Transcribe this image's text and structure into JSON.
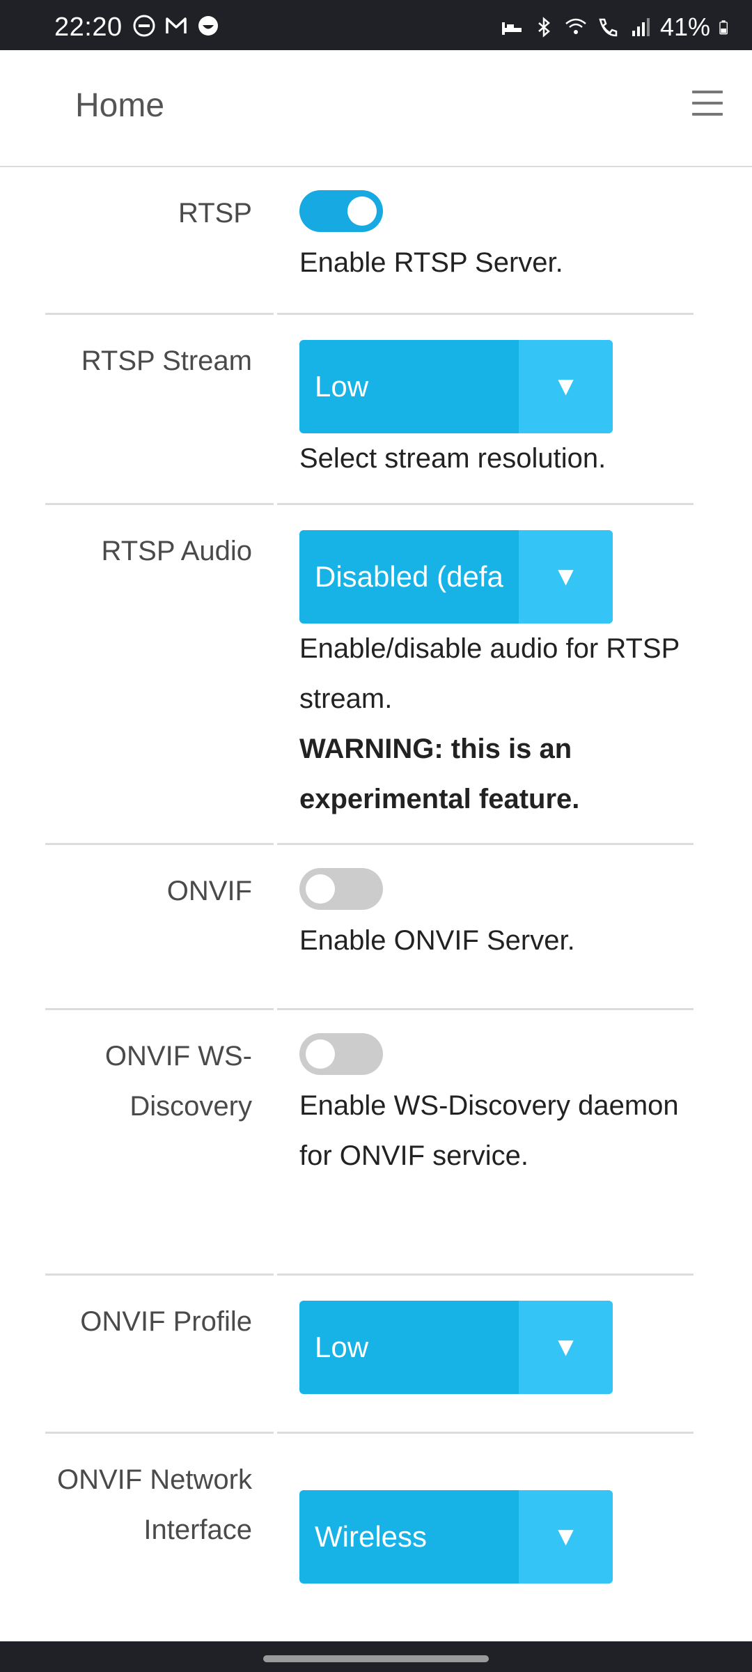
{
  "status_bar": {
    "time": "22:20",
    "left_icons": [
      "do-not-disturb-icon",
      "gmail-icon",
      "emoji-icon"
    ],
    "right_icons": [
      "bed-icon",
      "bluetooth-icon",
      "wifi-icon",
      "wifi-call-icon",
      "signal-icon",
      "battery-icon"
    ],
    "battery": "41%"
  },
  "header": {
    "title": "Home",
    "menu_icon": "hamburger-menu-icon"
  },
  "settings": [
    {
      "key": "rtsp",
      "label": "RTSP",
      "type": "toggle",
      "on": true,
      "desc": "Enable RTSP Server."
    },
    {
      "key": "rtsp_stream",
      "label": "RTSP Stream",
      "type": "select",
      "value": "Low",
      "desc": "Select stream resolution."
    },
    {
      "key": "rtsp_audio",
      "label": "RTSP Audio",
      "type": "select",
      "value": "Disabled (defa",
      "desc": "Enable/disable audio for RTSP stream.",
      "warning": "WARNING: this is an experimental feature."
    },
    {
      "key": "onvif",
      "label": "ONVIF",
      "type": "toggle",
      "on": false,
      "desc": "Enable ONVIF Server."
    },
    {
      "key": "onvif_ws",
      "label": "ONVIF WS-Discovery",
      "type": "toggle",
      "on": false,
      "desc": "Enable WS-Discovery daemon for ONVIF service."
    },
    {
      "key": "onvif_profile",
      "label": "ONVIF Profile",
      "type": "select",
      "value": "Low"
    },
    {
      "key": "onvif_net",
      "label": "ONVIF Network Interface",
      "type": "select",
      "value": "Wireless"
    }
  ],
  "select_arrow": "▼",
  "colors": {
    "accent": "#17a9e2",
    "select_bg": "#17b2e6",
    "select_arrow_bg": "#34c4f5",
    "toggle_off": "#cccccc"
  }
}
